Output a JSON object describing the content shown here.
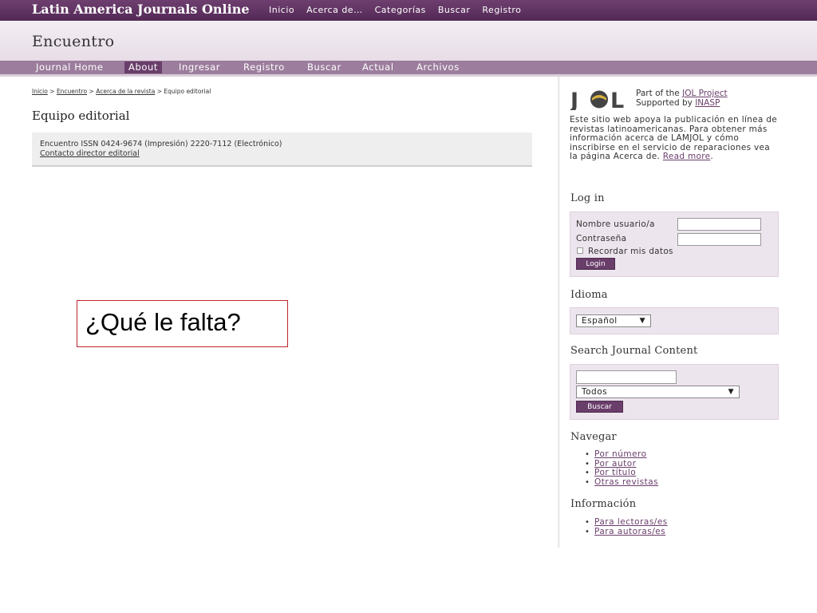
{
  "topbar": {
    "site_title": "Latin America Journals Online",
    "nav": [
      "Inicio",
      "Acerca de…",
      "Categorías",
      "Buscar",
      "Registro"
    ]
  },
  "journal": {
    "title": "Encuentro",
    "nav": [
      "Journal Home",
      "About",
      "Ingresar",
      "Registro",
      "Buscar",
      "Actual",
      "Archivos"
    ],
    "active_nav": "About"
  },
  "breadcrumb": {
    "items": [
      "Inicio",
      "Encuentro",
      "Acerca de la revista"
    ],
    "current": "Equipo editorial",
    "separator": ">"
  },
  "main": {
    "page_title": "Equipo editorial",
    "issn_line": "Encuentro ISSN 0424-9674 (Impresión) 2220-7112 (Electrónico)",
    "contact_link": "Contacto director editorial"
  },
  "overlay": {
    "question": "¿Qué le falta?"
  },
  "sidebar": {
    "logo_text": "JOL",
    "part_of_text": "Part of the",
    "part_of_link": "JOL Project",
    "supported_text": "Supported by",
    "supported_link": "INASP",
    "description": "Este sitio web apoya la publicación en línea de revistas latinoamericanas. Para obtener más información acerca de LAMJOL y cómo inscribirse en el servicio de reparaciones vea la página Acerca de.",
    "read_more": "Read more",
    "login": {
      "heading": "Log in",
      "username_label": "Nombre usuario/a",
      "password_label": "Contraseña",
      "remember_label": "Recordar mis datos",
      "button": "Login"
    },
    "language": {
      "heading": "Idioma",
      "selected": "Español"
    },
    "search": {
      "heading": "Search Journal Content",
      "scope_selected": "Todos",
      "button": "Buscar"
    },
    "browse": {
      "heading": "Navegar",
      "links": [
        "Por número",
        "Por autor",
        "Por título",
        "Otras revistas"
      ]
    },
    "information": {
      "heading": "Información",
      "links": [
        "Para lectoras/es",
        "Para autoras/es"
      ]
    }
  },
  "colors": {
    "brand_purple": "#6a3e6b",
    "nav_bar": "#9c7d9d",
    "overlay_border": "#c0262c"
  }
}
